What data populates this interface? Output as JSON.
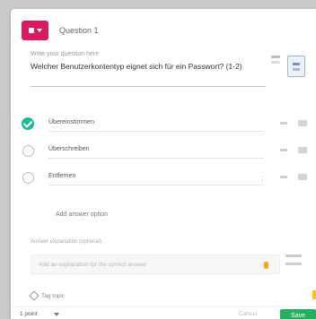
{
  "header": {
    "question_title": "Question 1"
  },
  "question": {
    "label": "Write your question here",
    "text": "Welcher Benutzerkontentyp eignet sich für ein Passwort? (1-2)"
  },
  "answers": [
    {
      "text": "Übereinstimmen",
      "correct": true
    },
    {
      "text": "Überschreiben",
      "correct": false
    },
    {
      "text": "Entfernen",
      "correct": false
    }
  ],
  "add_answer_label": "Add answer option",
  "explanation": {
    "label": "Answer explanation (optional)",
    "placeholder": "Add an explanation for the correct answer"
  },
  "tags_label": "Tag topic",
  "footer": {
    "points": "1 point",
    "cancel": "Cancel",
    "save": "Save"
  },
  "colors": {
    "accent": "#d81b60",
    "correct": "#1abc9c",
    "save": "#27ae60"
  }
}
